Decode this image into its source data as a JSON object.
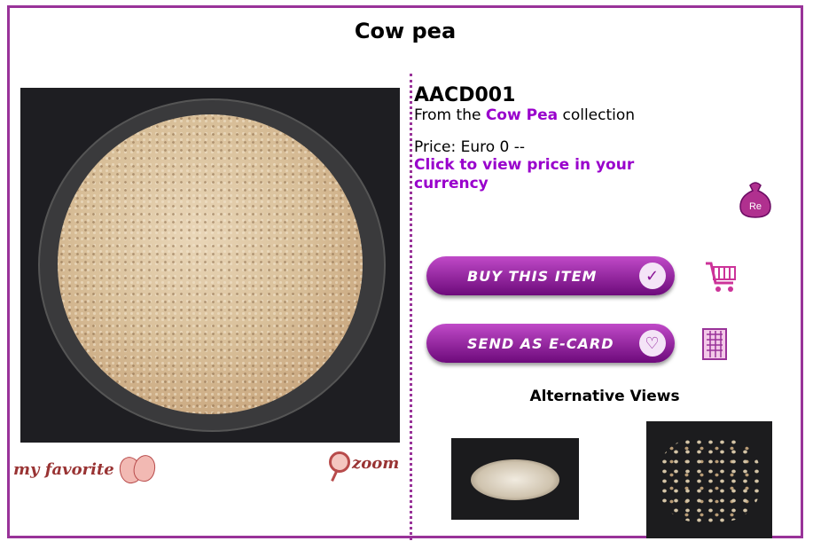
{
  "page": {
    "title": "Cow pea",
    "accent_color": "#993399",
    "link_color": "#9900cc"
  },
  "product": {
    "code": "AACD001",
    "collection_prefix": "From the",
    "collection_name": "Cow Pea",
    "collection_suffix": "collection",
    "price": "Price: Euro 0 --",
    "currency_link": "Click to view price in your currency",
    "currency_icon_label": "Re"
  },
  "actions": {
    "buy_label": "BUY THIS ITEM",
    "ecard_label": "SEND AS E-CARD",
    "favorite_label": "my favorite",
    "zoom_label": "zoom"
  },
  "alternative_views": {
    "title": "Alternative Views"
  },
  "icons": {
    "buy_badge": "checkmark-icon",
    "ecard_badge": "heart-icon",
    "cart": "shopping-cart-icon",
    "card": "greeting-card-icon",
    "money": "money-bag-icon",
    "favorite": "theater-masks-icon",
    "zoom": "magnifier-icon"
  }
}
